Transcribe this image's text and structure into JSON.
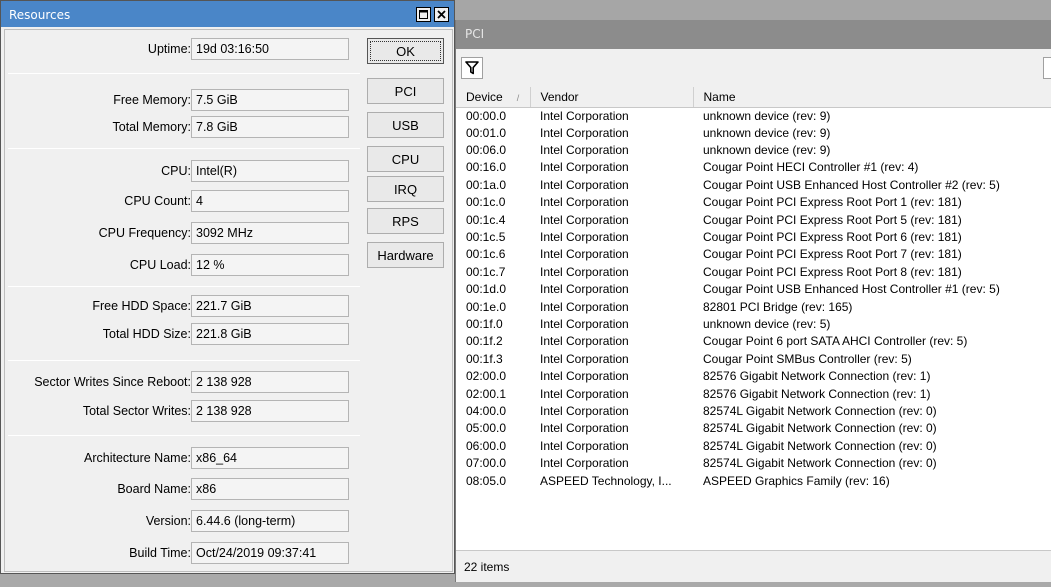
{
  "resources": {
    "title": "Resources",
    "fields": [
      {
        "label": "Uptime:",
        "value": "19d 03:16:50"
      },
      {
        "label": "Free Memory:",
        "value": "7.5 GiB"
      },
      {
        "label": "Total Memory:",
        "value": "7.8 GiB"
      },
      {
        "label": "CPU:",
        "value": "Intel(R)"
      },
      {
        "label": "CPU Count:",
        "value": "4"
      },
      {
        "label": "CPU Frequency:",
        "value": "3092 MHz"
      },
      {
        "label": "CPU Load:",
        "value": "12 %"
      },
      {
        "label": "Free HDD Space:",
        "value": "221.7 GiB"
      },
      {
        "label": "Total HDD Size:",
        "value": "221.8 GiB"
      },
      {
        "label": "Sector Writes Since Reboot:",
        "value": "2 138 928"
      },
      {
        "label": "Total Sector Writes:",
        "value": "2 138 928"
      },
      {
        "label": "Architecture Name:",
        "value": "x86_64"
      },
      {
        "label": "Board Name:",
        "value": "x86"
      },
      {
        "label": "Version:",
        "value": "6.44.6 (long-term)"
      },
      {
        "label": "Build Time:",
        "value": "Oct/24/2019 09:37:41"
      }
    ],
    "buttons": [
      "OK",
      "PCI",
      "USB",
      "CPU",
      "IRQ",
      "RPS",
      "Hardware"
    ]
  },
  "pci": {
    "title": "PCI",
    "columns": [
      "Device",
      "Vendor",
      "Name"
    ],
    "rows": [
      [
        "00:00.0",
        "Intel Corporation",
        "unknown device (rev: 9)"
      ],
      [
        "00:01.0",
        "Intel Corporation",
        "unknown device (rev: 9)"
      ],
      [
        "00:06.0",
        "Intel Corporation",
        "unknown device (rev: 9)"
      ],
      [
        "00:16.0",
        "Intel Corporation",
        "Cougar Point HECI Controller #1 (rev: 4)"
      ],
      [
        "00:1a.0",
        "Intel Corporation",
        "Cougar Point USB Enhanced Host Controller #2 (rev: 5)"
      ],
      [
        "00:1c.0",
        "Intel Corporation",
        "Cougar Point PCI Express Root Port 1 (rev: 181)"
      ],
      [
        "00:1c.4",
        "Intel Corporation",
        "Cougar Point PCI Express Root Port 5 (rev: 181)"
      ],
      [
        "00:1c.5",
        "Intel Corporation",
        "Cougar Point PCI Express Root Port 6 (rev: 181)"
      ],
      [
        "00:1c.6",
        "Intel Corporation",
        "Cougar Point PCI Express Root Port 7 (rev: 181)"
      ],
      [
        "00:1c.7",
        "Intel Corporation",
        "Cougar Point PCI Express Root Port 8 (rev: 181)"
      ],
      [
        "00:1d.0",
        "Intel Corporation",
        "Cougar Point USB Enhanced Host Controller #1 (rev: 5)"
      ],
      [
        "00:1e.0",
        "Intel Corporation",
        "82801 PCI Bridge (rev: 165)"
      ],
      [
        "00:1f.0",
        "Intel Corporation",
        "unknown device (rev: 5)"
      ],
      [
        "00:1f.2",
        "Intel Corporation",
        "Cougar Point 6 port SATA AHCI Controller (rev: 5)"
      ],
      [
        "00:1f.3",
        "Intel Corporation",
        "Cougar Point SMBus Controller (rev: 5)"
      ],
      [
        "02:00.0",
        "Intel Corporation",
        "82576 Gigabit Network Connection (rev: 1)"
      ],
      [
        "02:00.1",
        "Intel Corporation",
        "82576 Gigabit Network Connection (rev: 1)"
      ],
      [
        "04:00.0",
        "Intel Corporation",
        "82574L Gigabit Network Connection (rev: 0)"
      ],
      [
        "05:00.0",
        "Intel Corporation",
        "82574L Gigabit Network Connection (rev: 0)"
      ],
      [
        "06:00.0",
        "Intel Corporation",
        "82574L Gigabit Network Connection (rev: 0)"
      ],
      [
        "07:00.0",
        "Intel Corporation",
        "82574L Gigabit Network Connection (rev: 0)"
      ],
      [
        "08:05.0",
        "ASPEED Technology, I...",
        "ASPEED Graphics Family (rev: 16)"
      ]
    ],
    "status": "22 items"
  },
  "icons": {
    "filter": "filter-icon",
    "minimize": "minimize-icon",
    "close": "close-icon"
  },
  "colors": {
    "title_active": "#4a86c8",
    "title_inactive": "#8c8c8c",
    "panel": "#f0f0f0"
  }
}
